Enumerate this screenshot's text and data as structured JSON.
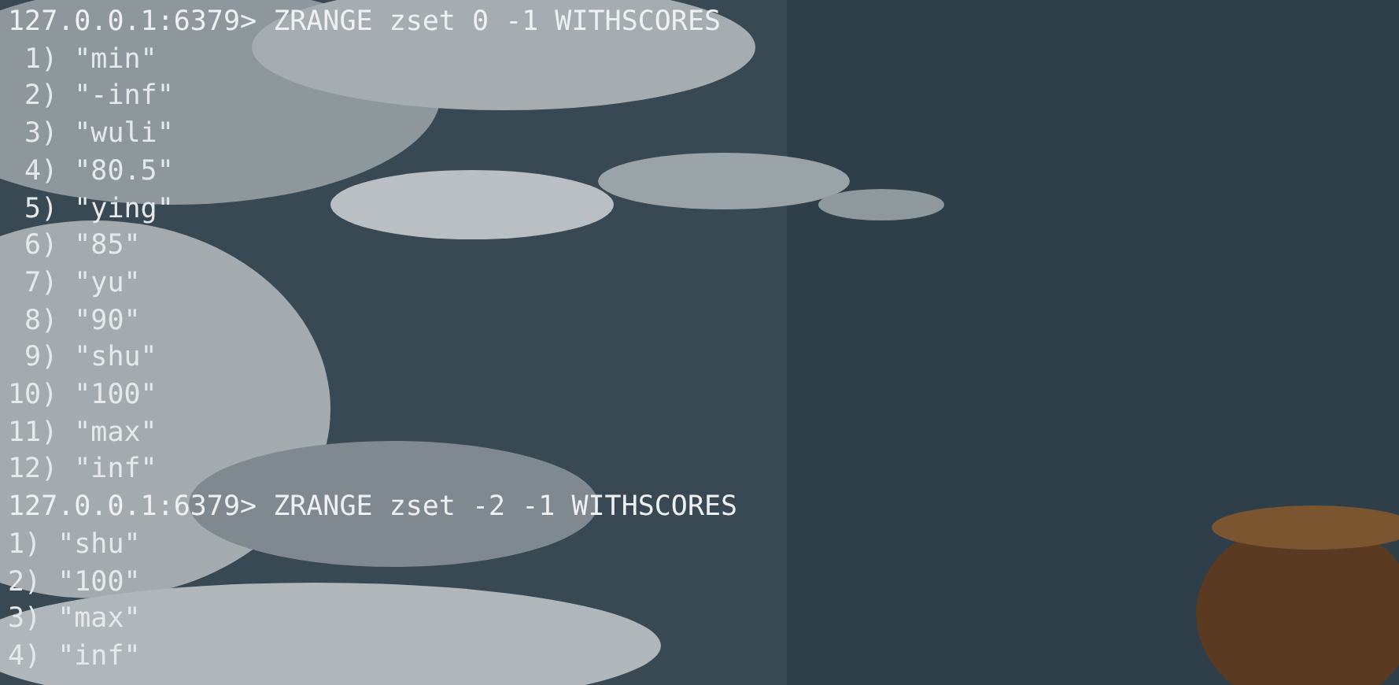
{
  "terminal": {
    "lines": [
      {
        "kind": "prompt",
        "text": "127.0.0.1:6379> ZRANGE zset 0 -1 WITHSCORES"
      },
      {
        "kind": "output",
        "text": " 1) \"min\""
      },
      {
        "kind": "output",
        "text": " 2) \"-inf\""
      },
      {
        "kind": "output",
        "text": " 3) \"wuli\""
      },
      {
        "kind": "output",
        "text": " 4) \"80.5\""
      },
      {
        "kind": "output",
        "text": " 5) \"ying\""
      },
      {
        "kind": "output",
        "text": " 6) \"85\""
      },
      {
        "kind": "output",
        "text": " 7) \"yu\""
      },
      {
        "kind": "output",
        "text": " 8) \"90\""
      },
      {
        "kind": "output",
        "text": " 9) \"shu\""
      },
      {
        "kind": "output",
        "text": "10) \"100\""
      },
      {
        "kind": "output",
        "text": "11) \"max\""
      },
      {
        "kind": "output",
        "text": "12) \"inf\""
      },
      {
        "kind": "prompt",
        "text": "127.0.0.1:6379> ZRANGE zset -2 -1 WITHSCORES"
      },
      {
        "kind": "output",
        "text": "1) \"shu\""
      },
      {
        "kind": "output",
        "text": "2) \"100\""
      },
      {
        "kind": "output",
        "text": "3) \"max\""
      },
      {
        "kind": "output",
        "text": "4) \"inf\""
      }
    ]
  }
}
